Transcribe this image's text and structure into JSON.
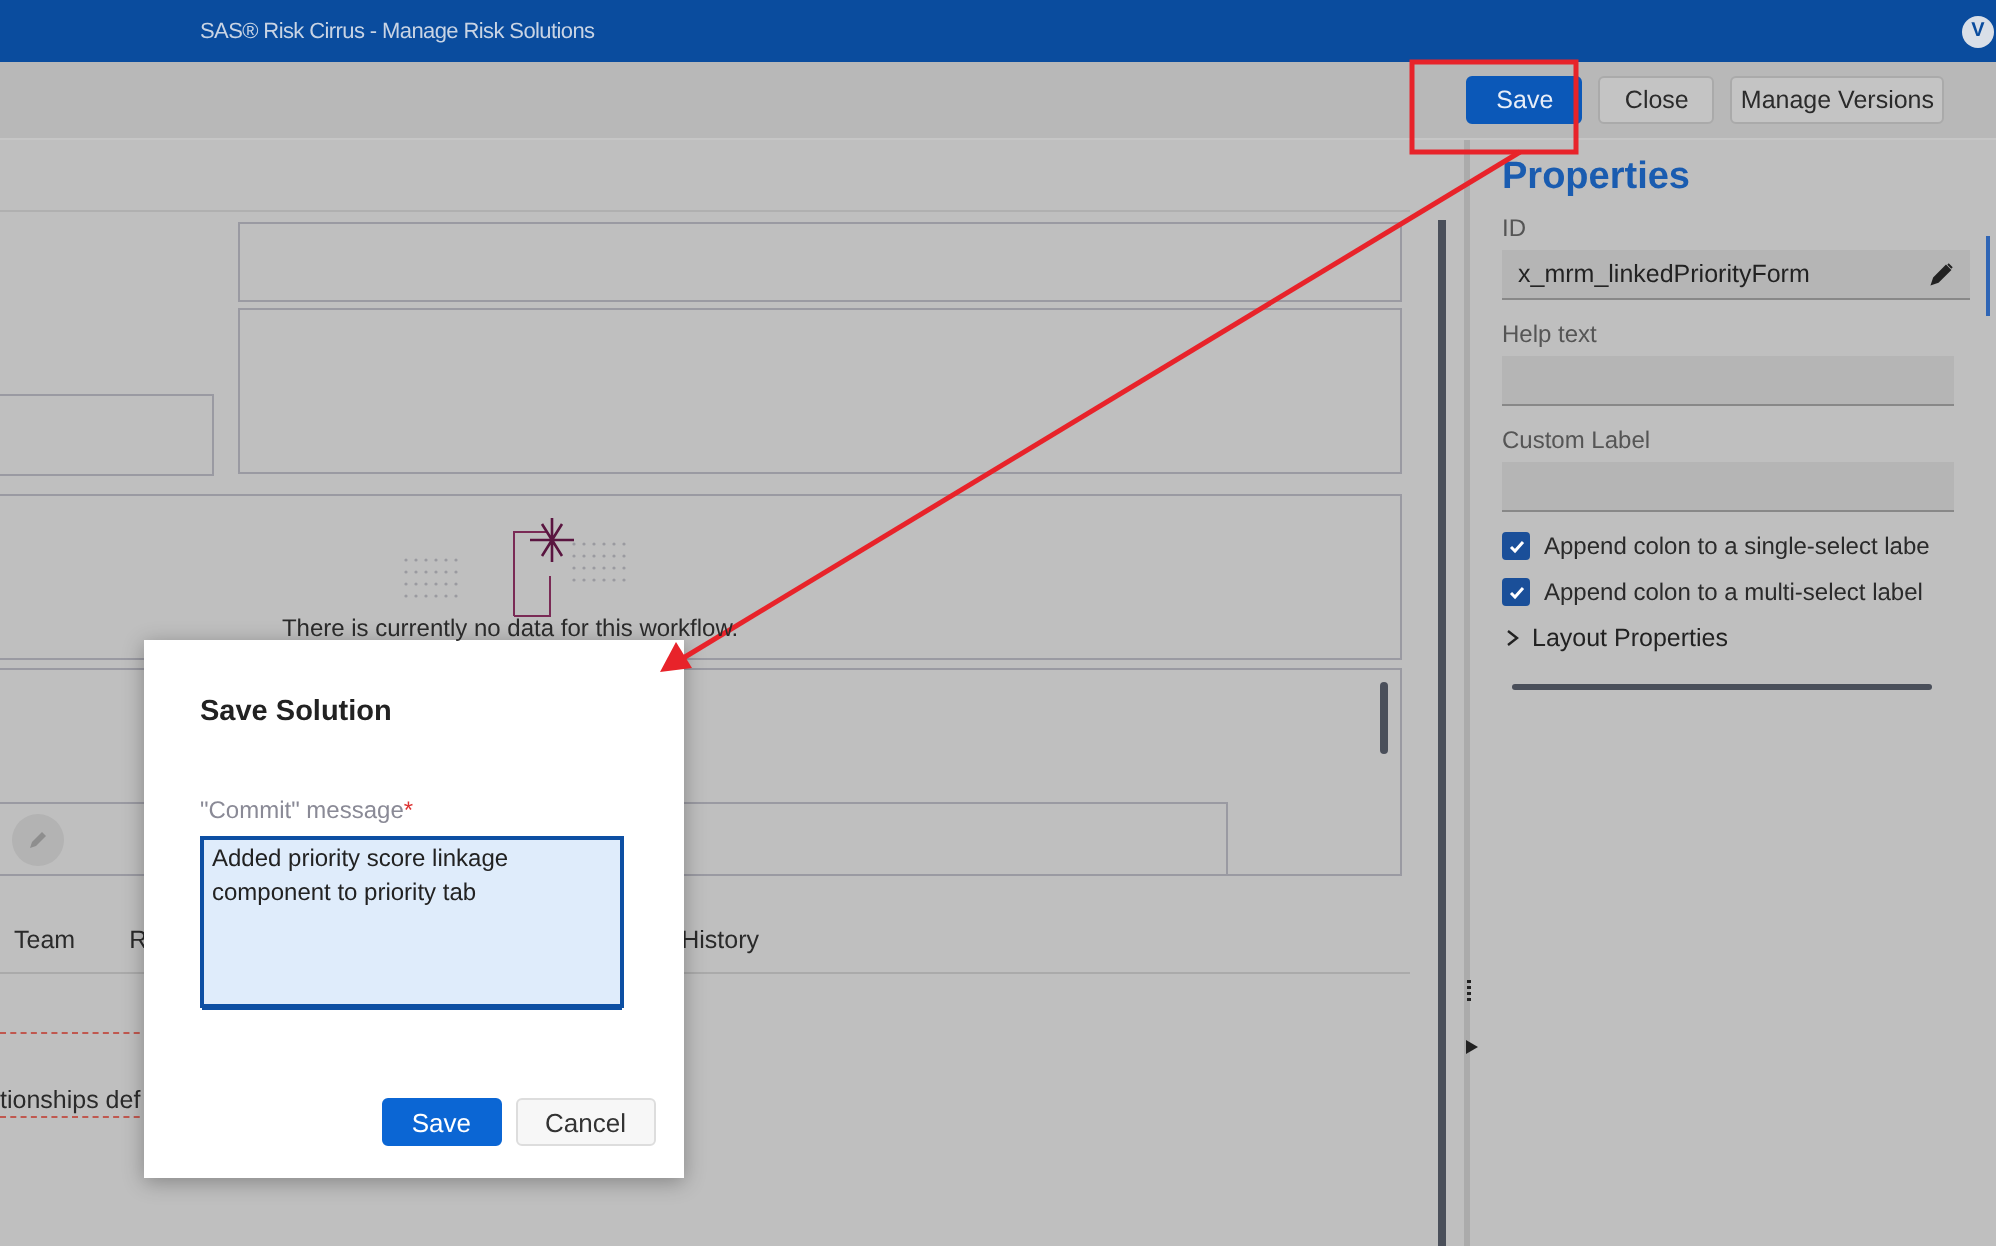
{
  "window": {
    "title": "SAS® Risk Cirrus - Manage Risk Solutions",
    "avatar": "V"
  },
  "toolbar": {
    "buttons": [
      {
        "label": "Save",
        "kind": "primary"
      },
      {
        "label": "Close",
        "kind": "secondary"
      },
      {
        "label": "Manage Versions",
        "kind": "secondary"
      }
    ]
  },
  "canvas": {
    "empty_state": "There is currently no data for this workflow.",
    "tabs": [
      {
        "label": "Team"
      },
      {
        "label": "R"
      },
      {
        "label": "History"
      }
    ],
    "row_text": "tionships def"
  },
  "properties": {
    "title": "Properties",
    "fields": [
      {
        "label": "ID",
        "value": "x_mrm_linkedPriorityForm",
        "kind": "editable"
      },
      {
        "label": "Help text",
        "kind": "plain"
      },
      {
        "label": "Custom Label",
        "kind": "plain"
      }
    ],
    "checkboxes": [
      {
        "label": "Append colon to a single-select labe",
        "checked": true
      },
      {
        "label": "Append colon to a multi-select label",
        "checked": true
      }
    ],
    "section": {
      "label": "Layout Properties",
      "expanded": false
    }
  },
  "dialog": {
    "title": "Save Solution",
    "field": {
      "label": "\"Commit\" message",
      "required": true,
      "required_mark": "*",
      "value": "Added priority score linkage component to priority tab"
    },
    "buttons": [
      {
        "label": "Save",
        "kind": "primary"
      },
      {
        "label": "Cancel",
        "kind": "secondary"
      }
    ]
  }
}
